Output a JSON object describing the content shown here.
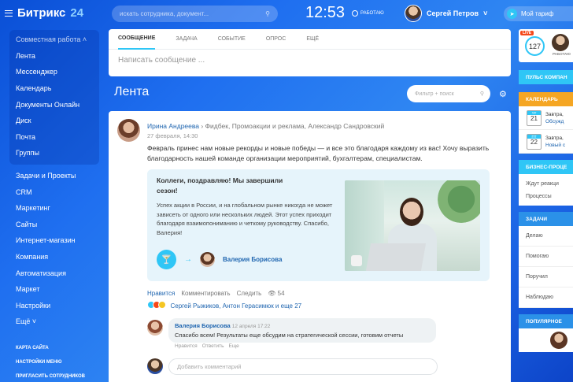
{
  "app": {
    "brand": "Битрикс",
    "brand_num": "24"
  },
  "header": {
    "search_placeholder": "искать сотрудника, документ...",
    "clock": "12:53",
    "work_status": "РАБОТАЮ",
    "user_name": "Сергей Петров",
    "tariff_label": "Мой тариф"
  },
  "sidebar": {
    "group_title": "Совместная работа ˄",
    "group_items": [
      "Лента",
      "Мессенджер",
      "Календарь",
      "Документы Онлайн",
      "Диск",
      "Почта",
      "Группы"
    ],
    "items": [
      "Задачи и Проекты",
      "CRM",
      "Маркетинг",
      "Сайты",
      "Интернет-магазин",
      "Компания",
      "Автоматизация",
      "Маркет",
      "Настройки",
      "Ещё ˅"
    ],
    "small_links": [
      "КАРТА САЙТА",
      "НАСТРОЙКИ МЕНЮ",
      "ПРИГЛАСИТЬ СОТРУДНИКОВ"
    ]
  },
  "composer": {
    "tabs": [
      "СООБЩЕНИЕ",
      "ЗАДАЧА",
      "СОБЫТИЕ",
      "ОПРОС",
      "ЕЩЁ"
    ],
    "placeholder": "Написать сообщение ..."
  },
  "feed": {
    "title": "Лента",
    "filter_placeholder": "Фильтр + поиск"
  },
  "post": {
    "author": "Ирина Андреева",
    "recipients": "› Фидбек, Промоакции и реклама, Александр Сандровский",
    "date": "27 февраля, 14:30",
    "text": "Февраль принес нам новые рекорды и новые победы — и все это благодаря каждому из вас! Хочу выразить благодарность нашей команде организации мероприятий, бухгалтерам, специалистам.",
    "banner_title": "Коллеги, поздравляю! Мы завершили сезон!",
    "banner_text": "Успех акции в России, и на глобальном рынке никогда не может зависеть от одного или нескольких людей. Этот успех приходит благодаря взаимопониманию и четкому руководству. Спасибо, Валерия!",
    "thanked_person": "Валерия Борисова",
    "actions": {
      "like": "Нравится",
      "comment": "Комментировать",
      "follow": "Следить",
      "views": "54"
    },
    "reactions_text": "Сергей Рыжиков, Антон Герасимюк и еще 27"
  },
  "comment": {
    "author": "Валерия Борисова",
    "time": "12 апреля 17:22",
    "text": "Спасибо всем! Результаты еще обсудим на стратегической сессии, готовим отчеты",
    "actions": [
      "Нравится",
      "Ответить",
      "Еще"
    ],
    "input_placeholder": "Добавить комментарий"
  },
  "right": {
    "live_badge": "LIVE",
    "live_count": "127",
    "live_label": "РАБОТАЮ",
    "pulse_title": "ПУЛЬС КОМПАН",
    "calendar_title": "КАЛЕНДАРЬ",
    "calendar": [
      {
        "weekday": "ЧТ",
        "day": "21",
        "when": "Завтра,",
        "event": "Обсужд"
      },
      {
        "weekday": "ПТ",
        "day": "22",
        "when": "Завтра,",
        "event": "Новый с"
      }
    ],
    "bp_title": "БИЗНЕС-ПРОЦЕ",
    "bp_items": [
      "Ждут реакци",
      "Процессы"
    ],
    "tasks_title": "ЗАДАЧИ",
    "tasks_items": [
      "Делаю",
      "Помогаю",
      "Поручил",
      "Наблюдаю"
    ],
    "popular_title": "ПОПУЛЯРНОЕ"
  },
  "colors": {
    "accent": "#2fc6f6",
    "link": "#2066b0",
    "calendar": "#f5a623",
    "bp": "#2fc6f6",
    "tasks": "#2b91e8",
    "live": "#f54819"
  }
}
